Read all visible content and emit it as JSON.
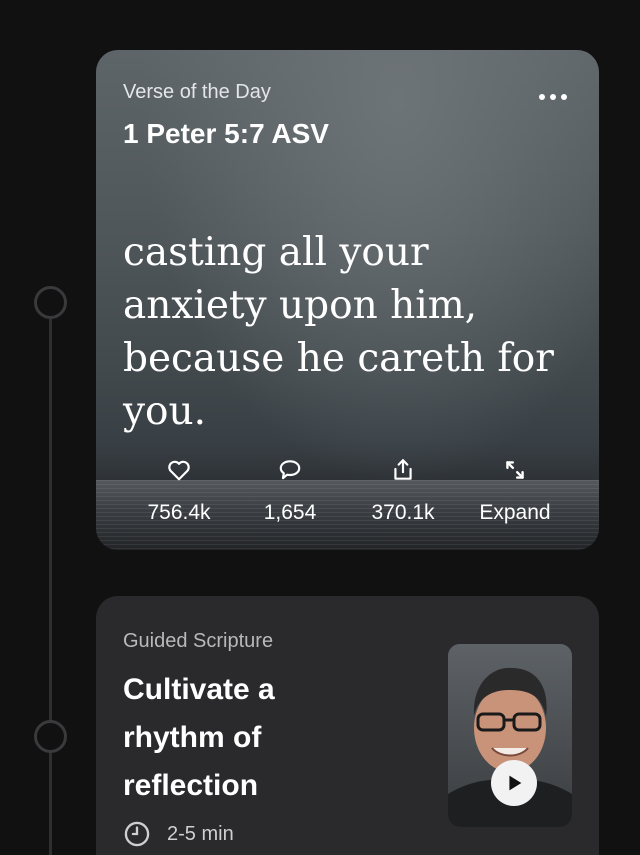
{
  "verse_card": {
    "label": "Verse of the Day",
    "reference": "1 Peter 5:7 ASV",
    "text": "casting all your anxiety upon him, because he careth for you.",
    "more_icon": "ellipsis-horizontal-icon",
    "actions": [
      {
        "icon": "heart-icon",
        "label": "756.4k"
      },
      {
        "icon": "comment-icon",
        "label": "1,654"
      },
      {
        "icon": "share-icon",
        "label": "370.1k"
      },
      {
        "icon": "expand-icon",
        "label": "Expand"
      }
    ]
  },
  "guided_card": {
    "label": "Guided Scripture",
    "title": "Cultivate a rhythm of reflection",
    "duration": "2-5 min",
    "duration_icon": "clock-icon",
    "thumbnail_icon": "play-icon"
  },
  "colors": {
    "background": "#121112",
    "card_dark": "#2a292b",
    "text_primary": "#ffffff",
    "text_secondary": "#b9b8ba"
  }
}
